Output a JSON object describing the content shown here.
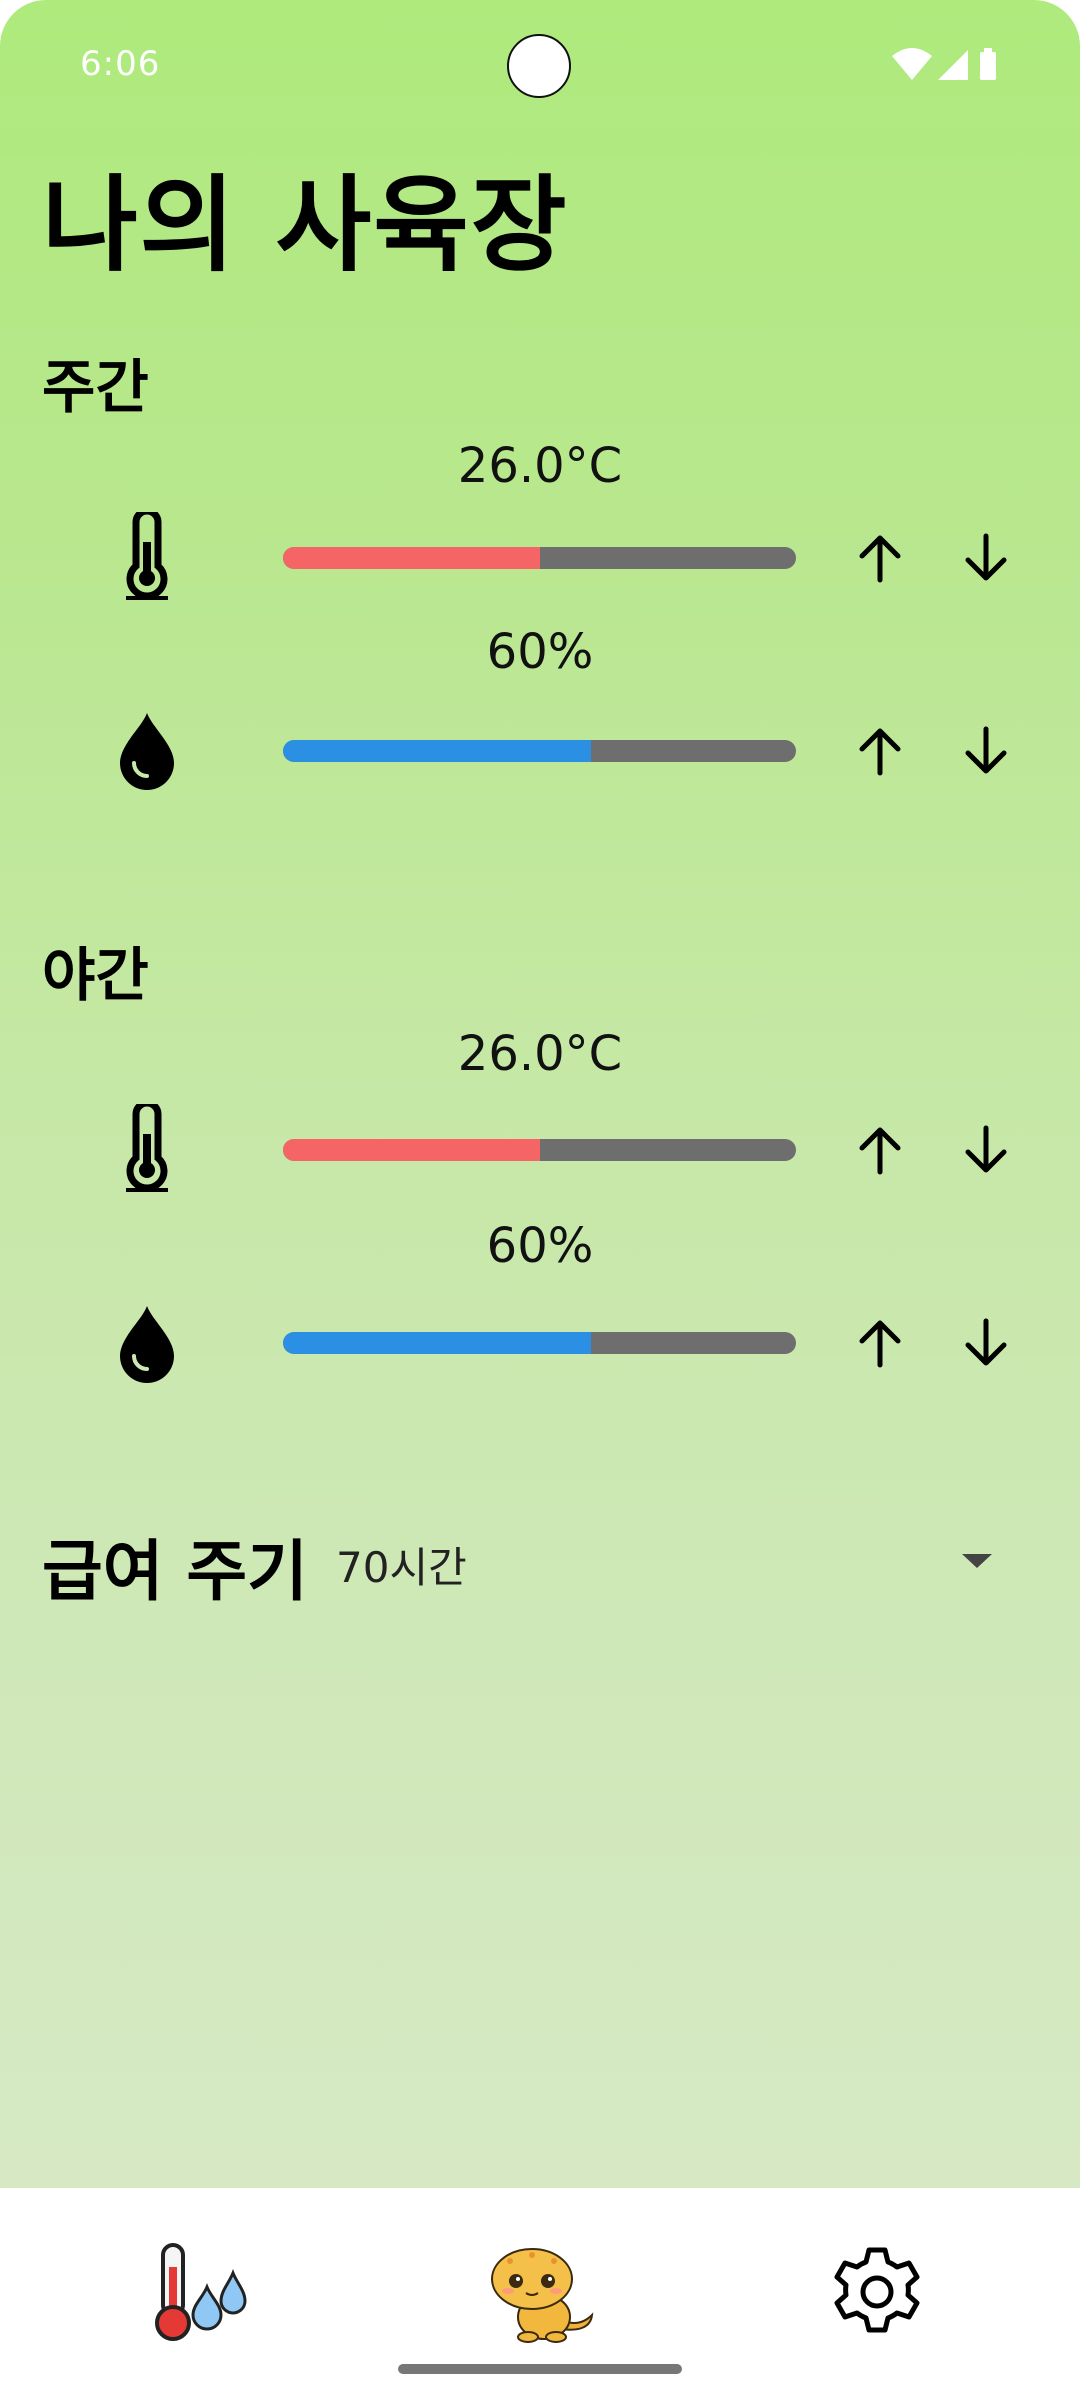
{
  "status_bar": {
    "time": "6:06"
  },
  "title": "나의 사육장",
  "day": {
    "title": "주간",
    "temperature": {
      "label": "26.0°C",
      "fraction": 0.5,
      "color": "#f56565"
    },
    "humidity": {
      "label": "60%",
      "fraction": 0.6,
      "color": "#2b90e3"
    }
  },
  "night": {
    "title": "야간",
    "temperature": {
      "label": "26.0°C",
      "fraction": 0.5,
      "color": "#f56565"
    },
    "humidity": {
      "label": "60%",
      "fraction": 0.6,
      "color": "#2b90e3"
    }
  },
  "feeding": {
    "label": "급여 주기",
    "value": "70시간"
  },
  "nav": {
    "items": [
      {
        "icon": "thermometer-water-icon"
      },
      {
        "icon": "lizard-icon"
      },
      {
        "icon": "gear-icon"
      }
    ]
  },
  "icons": {
    "up": "arrow-up-icon",
    "down": "arrow-down-icon",
    "temperature": "thermometer-icon",
    "humidity": "water-drop-icon",
    "dropdown": "chevron-down-icon"
  }
}
